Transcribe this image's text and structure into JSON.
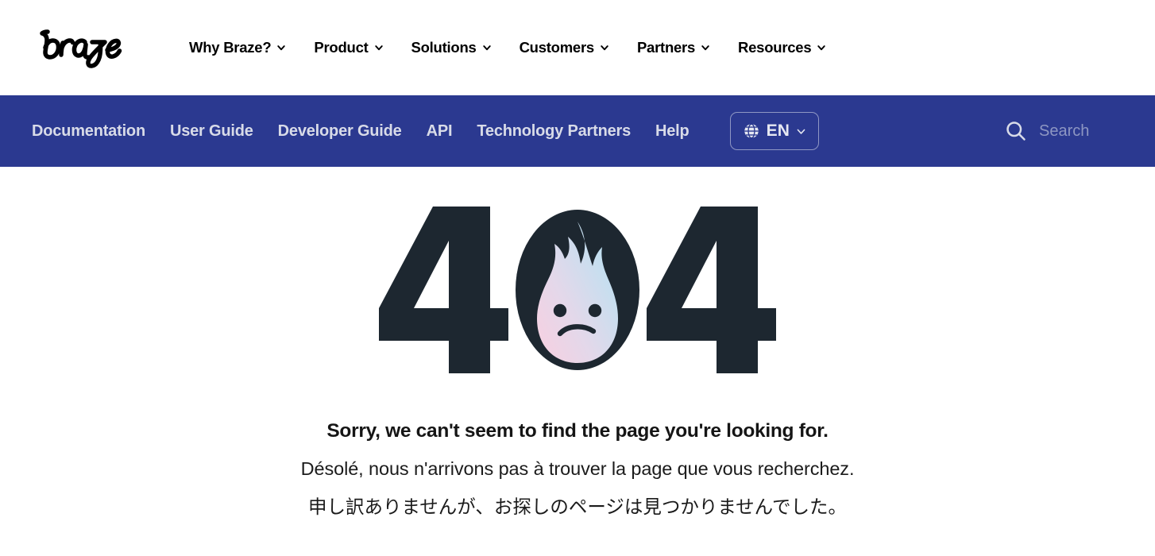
{
  "brand": {
    "logo_text": "braze",
    "logo_icon": "braze-wordmark-logo"
  },
  "colors": {
    "docs_bar_blue": "#2b3990",
    "digit_navy": "#1d2730",
    "flame_pink": "#f9cfe0",
    "flame_blue": "#b6e2f2",
    "docs_link_text": "#d8dbe8",
    "search_placeholder": "#8d96c2",
    "page_background": "#ffffff"
  },
  "top_nav": {
    "items": [
      {
        "label": "Why Braze?",
        "icon": "chevron-down-icon",
        "has_dropdown": true
      },
      {
        "label": "Product",
        "icon": "chevron-down-icon",
        "has_dropdown": true
      },
      {
        "label": "Solutions",
        "icon": "chevron-down-icon",
        "has_dropdown": true
      },
      {
        "label": "Customers",
        "icon": "chevron-down-icon",
        "has_dropdown": true
      },
      {
        "label": "Partners",
        "icon": "chevron-down-icon",
        "has_dropdown": true
      },
      {
        "label": "Resources",
        "icon": "chevron-down-icon",
        "has_dropdown": true
      }
    ]
  },
  "docs_nav": {
    "items": [
      {
        "label": "Documentation"
      },
      {
        "label": "User Guide"
      },
      {
        "label": "Developer Guide"
      },
      {
        "label": "API"
      },
      {
        "label": "Technology Partners"
      },
      {
        "label": "Help"
      }
    ],
    "language_selector": {
      "label": "EN",
      "globe_icon": "globe-icon",
      "chevron_icon": "chevron-down-icon"
    },
    "search": {
      "placeholder": "Search",
      "value": "",
      "icon": "search-icon"
    }
  },
  "error_page": {
    "code": "404",
    "graphic_alt": "404-flame-mascot-illustration",
    "mascot": {
      "name": "braze-flame-mascot",
      "expression": "sad-frown"
    },
    "message_en": "Sorry, we can't seem to find the page you're looking for.",
    "message_fr": "Désolé, nous n'arrivons pas à trouver la page que vous recherchez.",
    "message_ja": "申し訳ありませんが、お探しのページは見つかりませんでした。"
  }
}
